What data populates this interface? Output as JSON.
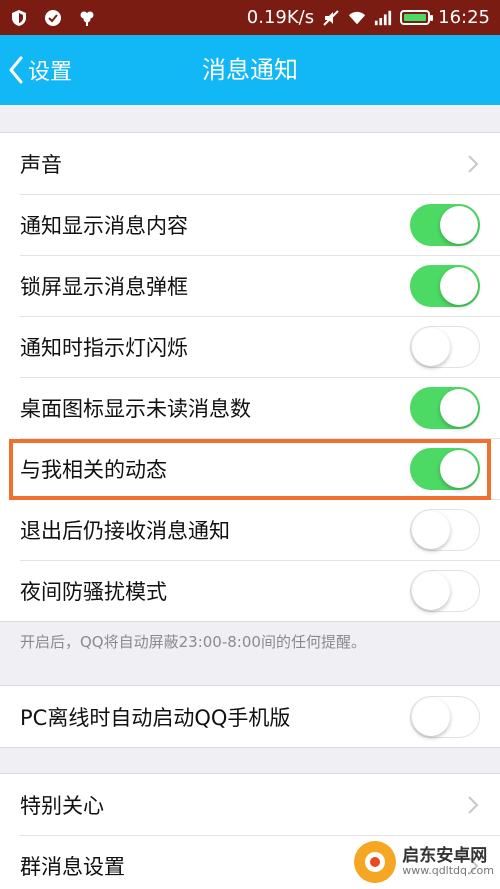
{
  "status_bar": {
    "network_speed": "0.19K/s",
    "time": "16:25",
    "icons": [
      "shield-icon",
      "check-circle-icon",
      "flower-icon",
      "mute-icon",
      "wifi-icon",
      "signal-icon",
      "battery-icon"
    ]
  },
  "nav": {
    "back_label": "设置",
    "title": "消息通知"
  },
  "group1": {
    "rows": [
      {
        "label": "声音",
        "type": "chevron"
      },
      {
        "label": "通知显示消息内容",
        "type": "toggle",
        "on": true
      },
      {
        "label": "锁屏显示消息弹框",
        "type": "toggle",
        "on": true
      },
      {
        "label": "通知时指示灯闪烁",
        "type": "toggle",
        "on": false
      },
      {
        "label": "桌面图标显示未读消息数",
        "type": "toggle",
        "on": true
      },
      {
        "label": "与我相关的动态",
        "type": "toggle",
        "on": true
      },
      {
        "label": "退出后仍接收消息通知",
        "type": "toggle",
        "on": false
      },
      {
        "label": "夜间防骚扰模式",
        "type": "toggle",
        "on": false
      }
    ],
    "hint": "开启后，QQ将自动屏蔽23:00-8:00间的任何提醒。"
  },
  "group2": {
    "rows": [
      {
        "label": "PC离线时自动启动QQ手机版",
        "type": "toggle",
        "on": false
      }
    ]
  },
  "group3": {
    "rows": [
      {
        "label": "特别关心",
        "type": "chevron"
      },
      {
        "label": "群消息设置",
        "type": "chevron"
      }
    ]
  },
  "watermark": {
    "name": "启东安卓网",
    "url": "www.qdltdq.com"
  },
  "colors": {
    "status_bar": "#7a1c12",
    "nav_bar": "#12b7f5",
    "toggle_on": "#4cd964",
    "highlight": "#f07030",
    "background": "#efeff4"
  }
}
